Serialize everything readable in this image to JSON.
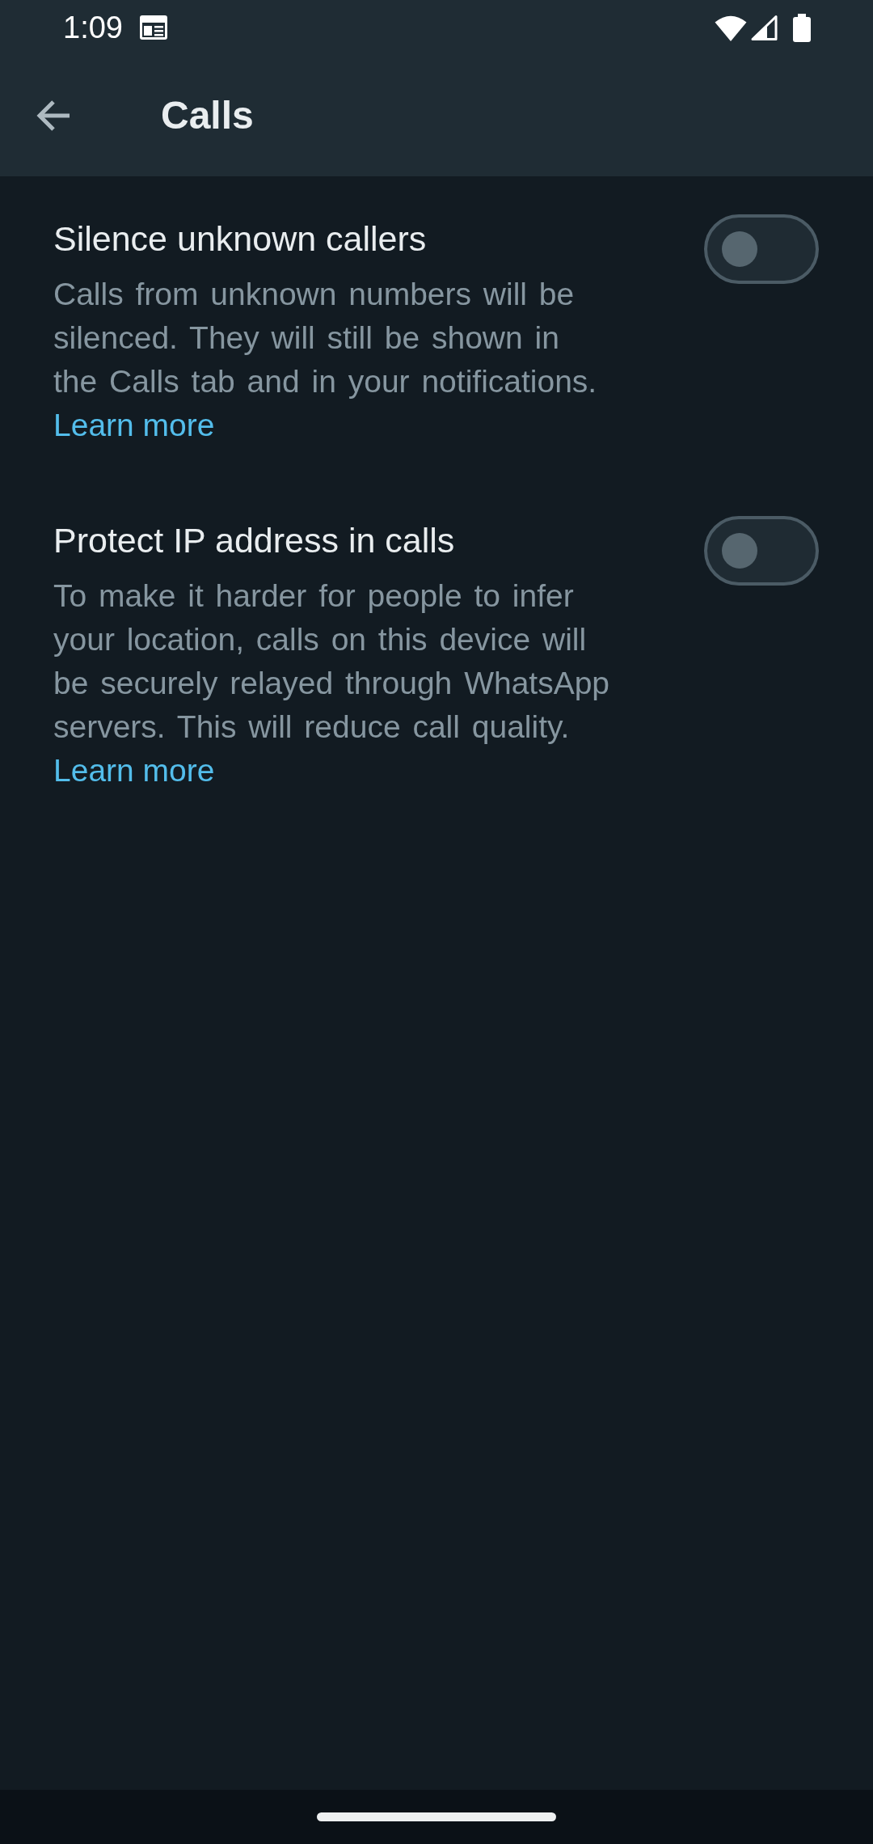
{
  "status_bar": {
    "time": "1:09"
  },
  "app_bar": {
    "title": "Calls"
  },
  "settings": [
    {
      "title": "Silence unknown callers",
      "description": "Calls from unknown numbers will be silenced. They will still be shown in the Calls tab and in your notifications.",
      "link": "Learn more",
      "on": false
    },
    {
      "title": "Protect IP address in calls",
      "description": "To make it harder for people to infer your location, calls on this device will be securely relayed through WhatsApp servers. This will reduce call quality.",
      "link": "Learn more",
      "on": false
    }
  ]
}
